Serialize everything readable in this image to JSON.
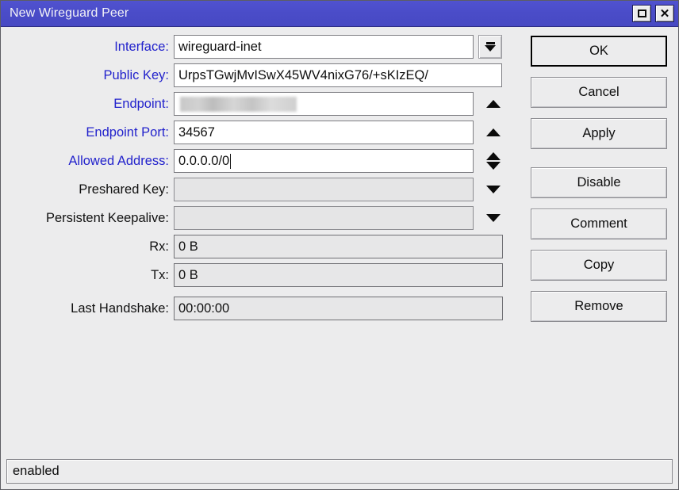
{
  "window": {
    "title": "New Wireguard Peer",
    "titlebar_color": "#4a4cc8",
    "label_blue": "#2222cc",
    "controls": {
      "maximize": "maximize-icon",
      "close": "close-icon"
    }
  },
  "form": {
    "rows": [
      {
        "label": "Interface:",
        "label_color": "blue",
        "value": "wireguard-inet",
        "control": "dropdown-button",
        "state": "editable"
      },
      {
        "label": "Public Key:",
        "label_color": "blue",
        "value": "UrpsTGwjMvISwX45WV4nixG76/+sKIzEQ/",
        "control": "none",
        "state": "editable"
      },
      {
        "label": "Endpoint:",
        "label_color": "blue",
        "value": "",
        "value_redacted": true,
        "control": "spinner-up",
        "state": "editable"
      },
      {
        "label": "Endpoint Port:",
        "label_color": "blue",
        "value": "34567",
        "control": "spinner-up",
        "state": "editable"
      },
      {
        "label": "Allowed Address:",
        "label_color": "blue",
        "value": "0.0.0.0/0",
        "control": "spinner-updown",
        "state": "focused"
      },
      {
        "label": "Preshared Key:",
        "label_color": "black",
        "value": "",
        "control": "spinner-down",
        "state": "empty"
      },
      {
        "label": "Persistent Keepalive:",
        "label_color": "black",
        "value": "",
        "control": "spinner-down",
        "state": "empty"
      },
      {
        "label": "Rx:",
        "label_color": "black",
        "value": "0 B",
        "control": "none",
        "state": "readonly"
      },
      {
        "label": "Tx:",
        "label_color": "black",
        "value": "0 B",
        "control": "none",
        "state": "readonly"
      },
      {
        "label": "Last Handshake:",
        "label_color": "black",
        "value": "00:00:00",
        "control": "none",
        "state": "readonly"
      }
    ]
  },
  "buttons": [
    {
      "label": "OK",
      "focused": true
    },
    {
      "label": "Cancel",
      "focused": false
    },
    {
      "label": "Apply",
      "focused": false
    },
    {
      "label": "Disable",
      "focused": false
    },
    {
      "label": "Comment",
      "focused": false
    },
    {
      "label": "Copy",
      "focused": false
    },
    {
      "label": "Remove",
      "focused": false
    }
  ],
  "statusbar": {
    "text": "enabled"
  }
}
